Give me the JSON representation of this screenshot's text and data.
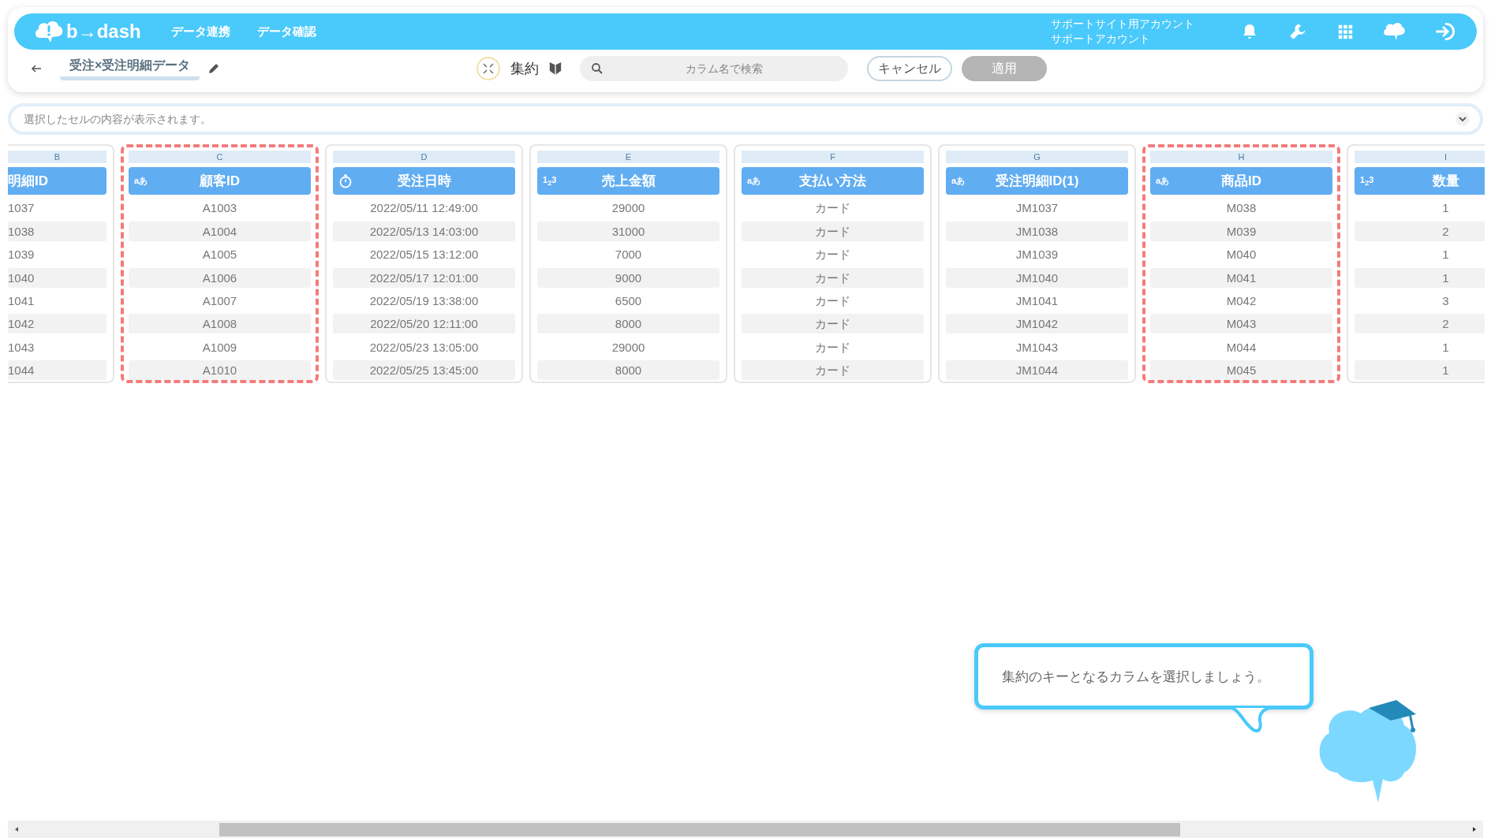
{
  "header": {
    "logo": "b→dash",
    "nav": [
      {
        "label": "データ連携"
      },
      {
        "label": "データ確認"
      }
    ],
    "account": {
      "site": "サポートサイト用アカウント",
      "name": "サポートアカウント"
    }
  },
  "toolbar": {
    "title": "受注×受注明細データ",
    "mode": "集約",
    "search": {
      "placeholder": "カラム名で検索"
    },
    "buttons": [
      {
        "label": "キャンセル",
        "disabled": false
      },
      {
        "label": "適用",
        "disabled": true
      }
    ]
  },
  "cell_viewer": {
    "placeholder": "選択したセルの内容が表示されます。"
  },
  "columns": [
    {
      "letter": "B",
      "name": "明細ID",
      "kind": "text",
      "selected": false,
      "cells": [
        "1037",
        "1038",
        "1039",
        "1040",
        "1041",
        "1042",
        "1043",
        "1044"
      ]
    },
    {
      "letter": "C",
      "name": "顧客ID",
      "kind": "text",
      "type_mark": "aあ",
      "selected": true,
      "cells": [
        "A1003",
        "A1004",
        "A1005",
        "A1006",
        "A1007",
        "A1008",
        "A1009",
        "A1010"
      ]
    },
    {
      "letter": "D",
      "name": "受注日時",
      "kind": "datetime",
      "selected": false,
      "cells": [
        "2022/05/11 12:49:00",
        "2022/05/13 14:03:00",
        "2022/05/15 13:12:00",
        "2022/05/17 12:01:00",
        "2022/05/19 13:38:00",
        "2022/05/20 12:11:00",
        "2022/05/23 13:05:00",
        "2022/05/25 13:45:00"
      ]
    },
    {
      "letter": "E",
      "name": "売上金額",
      "kind": "number",
      "type_mark": "1$_{2}$3",
      "selected": false,
      "cells": [
        "29000",
        "31000",
        "7000",
        "9000",
        "6500",
        "8000",
        "29000",
        "8000"
      ]
    },
    {
      "letter": "F",
      "name": "支払い方法",
      "kind": "text",
      "type_mark": "aあ",
      "selected": false,
      "cells": [
        "カード",
        "カード",
        "カード",
        "カード",
        "カード",
        "カード",
        "カード",
        "カード"
      ]
    },
    {
      "letter": "G",
      "name": "受注明細ID(1)",
      "kind": "text",
      "type_mark": "aあ",
      "selected": false,
      "cells": [
        "JM1037",
        "JM1038",
        "JM1039",
        "JM1040",
        "JM1041",
        "JM1042",
        "JM1043",
        "JM1044"
      ]
    },
    {
      "letter": "H",
      "name": "商品ID",
      "kind": "text",
      "type_mark": "aあ",
      "selected": true,
      "cells": [
        "M038",
        "M039",
        "M040",
        "M041",
        "M042",
        "M043",
        "M044",
        "M045"
      ]
    },
    {
      "letter": "I",
      "name": "数量",
      "kind": "number",
      "type_mark": "1$_{2}$3",
      "selected": false,
      "cells": [
        "1",
        "2",
        "1",
        "1",
        "3",
        "2",
        "1",
        "1"
      ]
    }
  ],
  "hint": {
    "text": "集約のキーとなるカラムを選択しましょう。"
  }
}
